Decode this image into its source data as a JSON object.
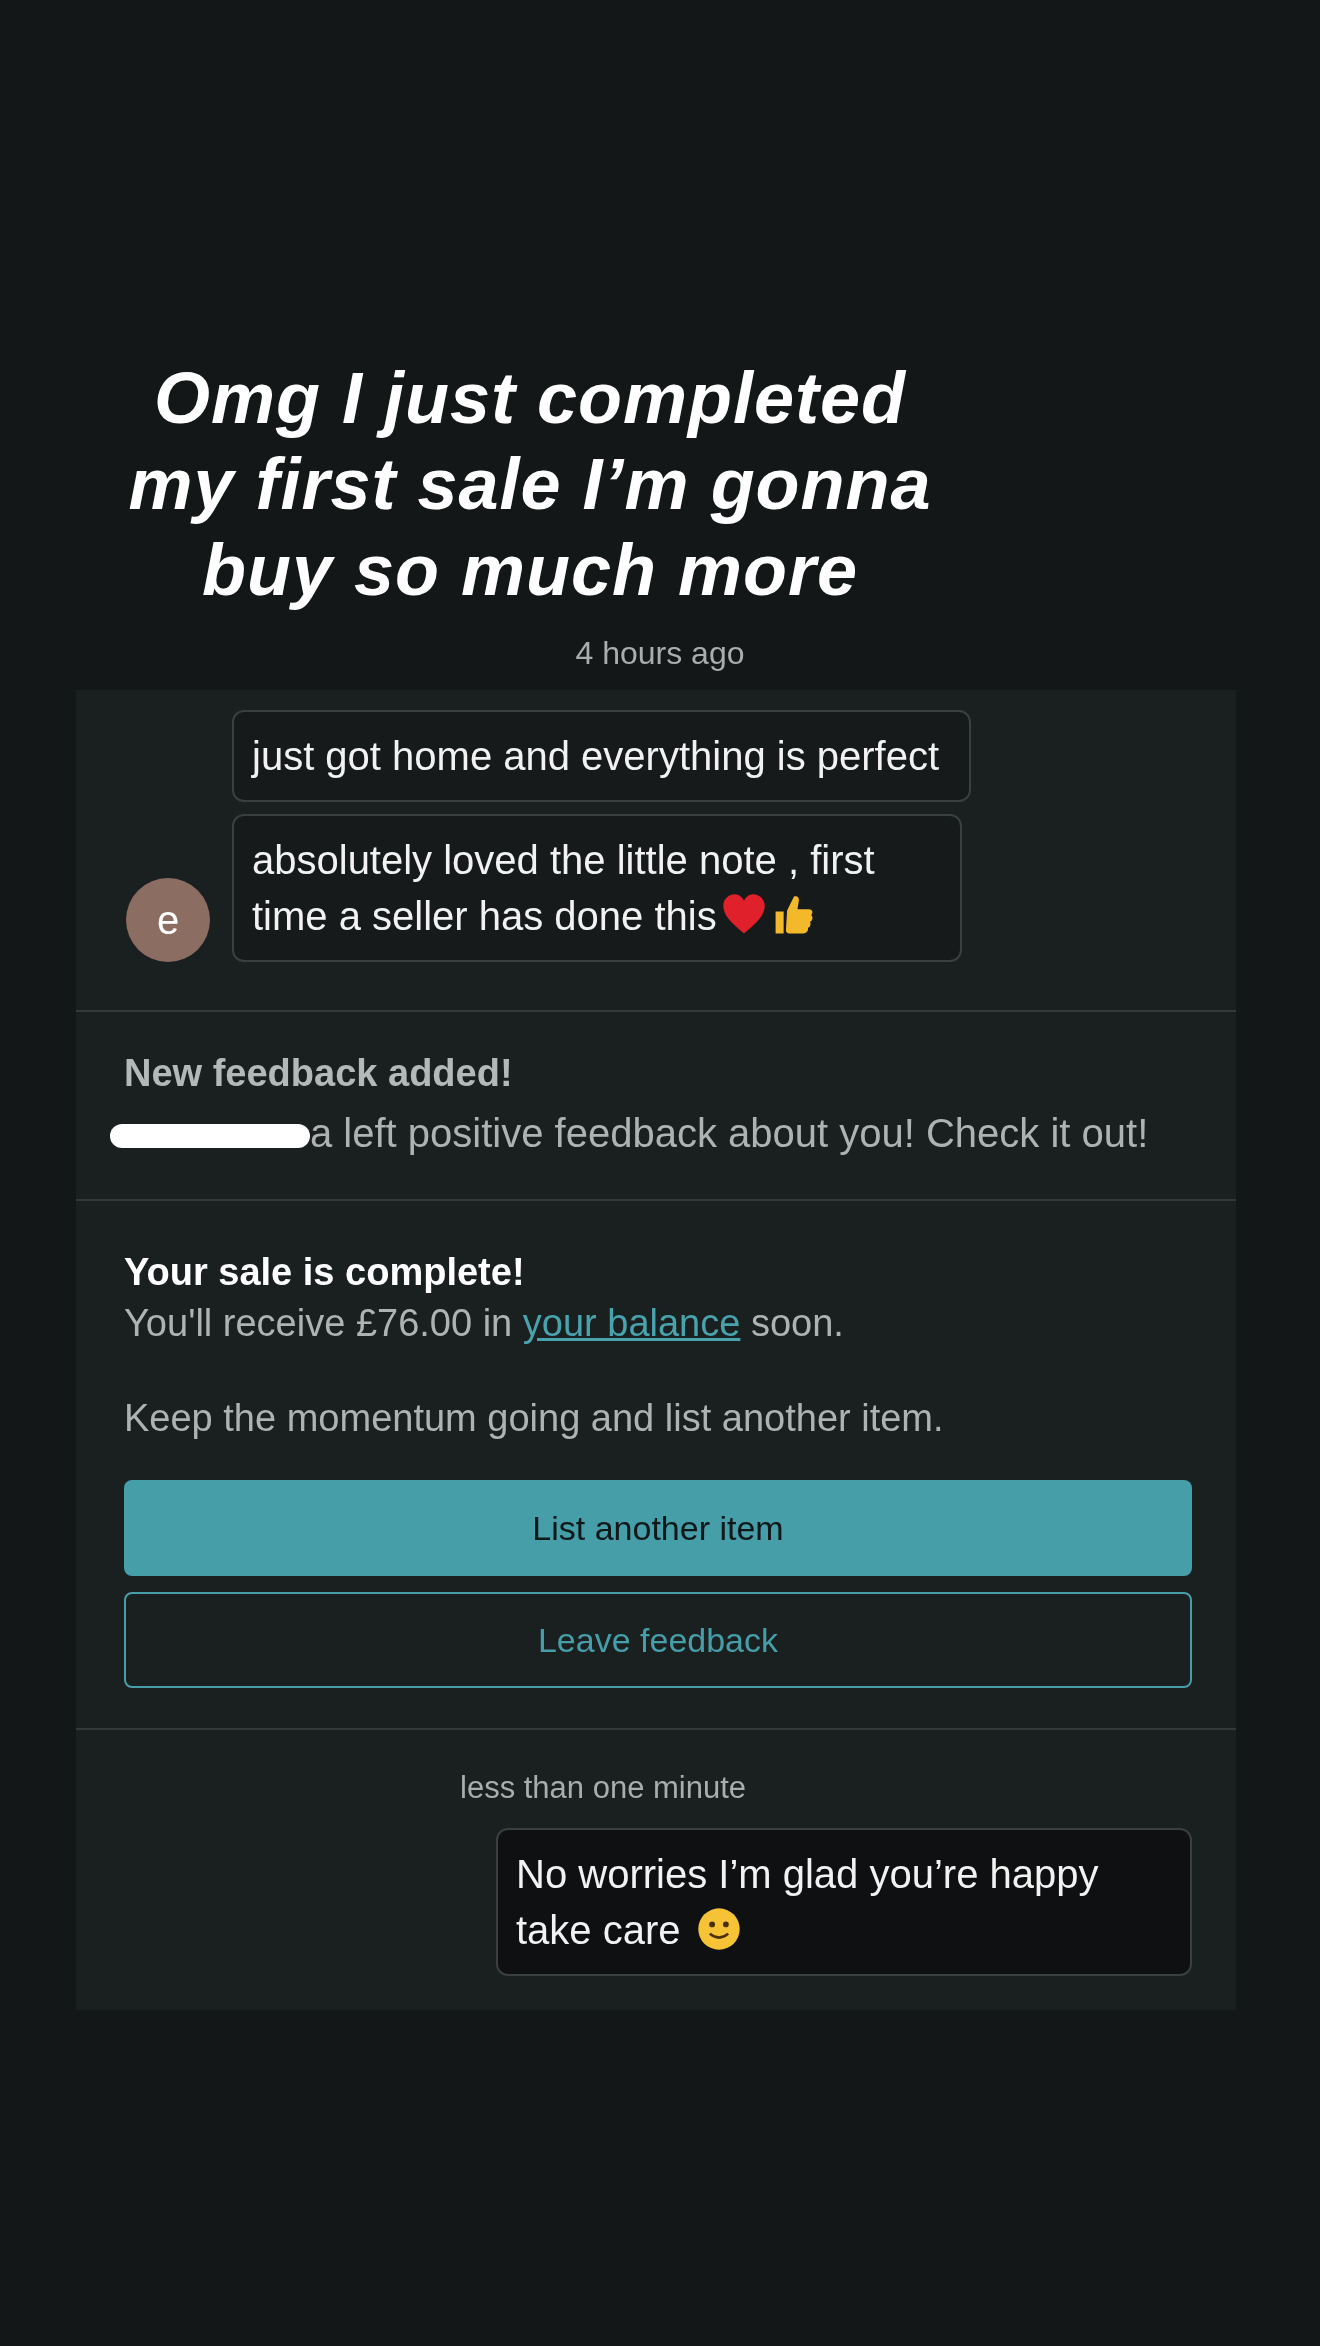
{
  "caption": [
    "Omg I just completed",
    "my first sale I’m gonna",
    "buy so much more"
  ],
  "timestamp": "4 hours ago",
  "sender": {
    "initial": "e"
  },
  "incoming": [
    {
      "text": "just got home and everything is perfect"
    },
    {
      "text": "absolutely loved the little note , first time a seller has done this"
    }
  ],
  "feedback": {
    "title": "New feedback added!",
    "redacted": true,
    "text": "a left positive feedback about you! Check it out!"
  },
  "sale": {
    "title": "Your sale is complete!",
    "before": "You'll receive £76.00 in",
    "link": "your balance",
    "after": "soon.",
    "note": "Keep the momentum going and list another item.",
    "buttons": [
      {
        "label": "List another item",
        "kind": "primary"
      },
      {
        "label": "Leave feedback",
        "kind": "outline"
      }
    ]
  },
  "reply": {
    "time": "less than one minute",
    "text": "No worries I’m glad you’re happy take care"
  }
}
